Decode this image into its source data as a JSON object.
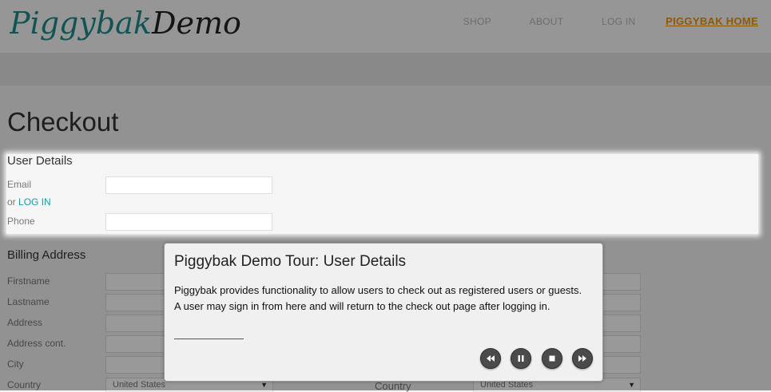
{
  "brand": {
    "logo_text_1": "Piggybak",
    "logo_text_2": "Demo",
    "color_1": "#1f8d8d",
    "color_2": "#222222"
  },
  "nav": {
    "shop": "SHOP",
    "about": "ABOUT",
    "login": "LOG IN",
    "home": "PIGGYBAK HOME"
  },
  "page": {
    "title": "Checkout"
  },
  "user_details": {
    "title": "User Details",
    "email_label": "Email",
    "or_text": "or",
    "login_link": "LOG IN",
    "phone_label": "Phone"
  },
  "billing": {
    "title": "Billing Address",
    "fields": [
      "Firstname",
      "Lastname",
      "Address",
      "Address cont.",
      "City",
      "Country"
    ],
    "country_value": "United States",
    "country_label_right": "Country",
    "country_value_right": "United States"
  },
  "tour": {
    "title": "Piggybak Demo Tour: User Details",
    "line1": "Piggybak provides functionality to allow users to check out as registered users or guests.",
    "line2": "A user may sign in from here and will return to the check out page after logging in.",
    "controls": [
      "rewind-icon",
      "pause-icon",
      "stop-icon",
      "fast-forward-icon"
    ]
  }
}
